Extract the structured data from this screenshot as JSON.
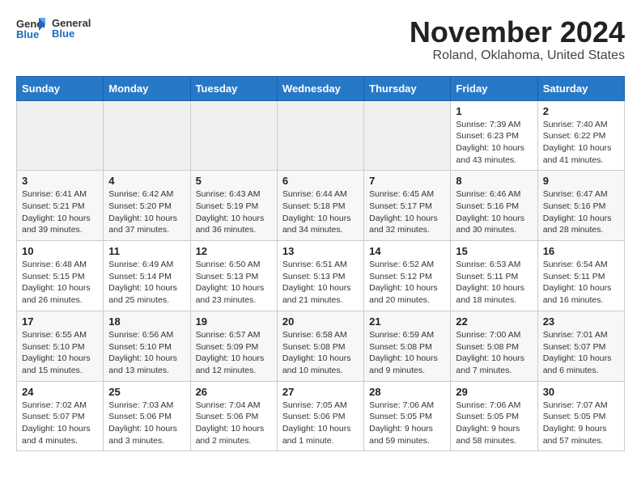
{
  "header": {
    "logo_general": "General",
    "logo_blue": "Blue",
    "month_title": "November 2024",
    "location": "Roland, Oklahoma, United States"
  },
  "weekdays": [
    "Sunday",
    "Monday",
    "Tuesday",
    "Wednesday",
    "Thursday",
    "Friday",
    "Saturday"
  ],
  "weeks": [
    [
      {
        "day": "",
        "detail": ""
      },
      {
        "day": "",
        "detail": ""
      },
      {
        "day": "",
        "detail": ""
      },
      {
        "day": "",
        "detail": ""
      },
      {
        "day": "",
        "detail": ""
      },
      {
        "day": "1",
        "detail": "Sunrise: 7:39 AM\nSunset: 6:23 PM\nDaylight: 10 hours and 43 minutes."
      },
      {
        "day": "2",
        "detail": "Sunrise: 7:40 AM\nSunset: 6:22 PM\nDaylight: 10 hours and 41 minutes."
      }
    ],
    [
      {
        "day": "3",
        "detail": "Sunrise: 6:41 AM\nSunset: 5:21 PM\nDaylight: 10 hours and 39 minutes."
      },
      {
        "day": "4",
        "detail": "Sunrise: 6:42 AM\nSunset: 5:20 PM\nDaylight: 10 hours and 37 minutes."
      },
      {
        "day": "5",
        "detail": "Sunrise: 6:43 AM\nSunset: 5:19 PM\nDaylight: 10 hours and 36 minutes."
      },
      {
        "day": "6",
        "detail": "Sunrise: 6:44 AM\nSunset: 5:18 PM\nDaylight: 10 hours and 34 minutes."
      },
      {
        "day": "7",
        "detail": "Sunrise: 6:45 AM\nSunset: 5:17 PM\nDaylight: 10 hours and 32 minutes."
      },
      {
        "day": "8",
        "detail": "Sunrise: 6:46 AM\nSunset: 5:16 PM\nDaylight: 10 hours and 30 minutes."
      },
      {
        "day": "9",
        "detail": "Sunrise: 6:47 AM\nSunset: 5:16 PM\nDaylight: 10 hours and 28 minutes."
      }
    ],
    [
      {
        "day": "10",
        "detail": "Sunrise: 6:48 AM\nSunset: 5:15 PM\nDaylight: 10 hours and 26 minutes."
      },
      {
        "day": "11",
        "detail": "Sunrise: 6:49 AM\nSunset: 5:14 PM\nDaylight: 10 hours and 25 minutes."
      },
      {
        "day": "12",
        "detail": "Sunrise: 6:50 AM\nSunset: 5:13 PM\nDaylight: 10 hours and 23 minutes."
      },
      {
        "day": "13",
        "detail": "Sunrise: 6:51 AM\nSunset: 5:13 PM\nDaylight: 10 hours and 21 minutes."
      },
      {
        "day": "14",
        "detail": "Sunrise: 6:52 AM\nSunset: 5:12 PM\nDaylight: 10 hours and 20 minutes."
      },
      {
        "day": "15",
        "detail": "Sunrise: 6:53 AM\nSunset: 5:11 PM\nDaylight: 10 hours and 18 minutes."
      },
      {
        "day": "16",
        "detail": "Sunrise: 6:54 AM\nSunset: 5:11 PM\nDaylight: 10 hours and 16 minutes."
      }
    ],
    [
      {
        "day": "17",
        "detail": "Sunrise: 6:55 AM\nSunset: 5:10 PM\nDaylight: 10 hours and 15 minutes."
      },
      {
        "day": "18",
        "detail": "Sunrise: 6:56 AM\nSunset: 5:10 PM\nDaylight: 10 hours and 13 minutes."
      },
      {
        "day": "19",
        "detail": "Sunrise: 6:57 AM\nSunset: 5:09 PM\nDaylight: 10 hours and 12 minutes."
      },
      {
        "day": "20",
        "detail": "Sunrise: 6:58 AM\nSunset: 5:08 PM\nDaylight: 10 hours and 10 minutes."
      },
      {
        "day": "21",
        "detail": "Sunrise: 6:59 AM\nSunset: 5:08 PM\nDaylight: 10 hours and 9 minutes."
      },
      {
        "day": "22",
        "detail": "Sunrise: 7:00 AM\nSunset: 5:08 PM\nDaylight: 10 hours and 7 minutes."
      },
      {
        "day": "23",
        "detail": "Sunrise: 7:01 AM\nSunset: 5:07 PM\nDaylight: 10 hours and 6 minutes."
      }
    ],
    [
      {
        "day": "24",
        "detail": "Sunrise: 7:02 AM\nSunset: 5:07 PM\nDaylight: 10 hours and 4 minutes."
      },
      {
        "day": "25",
        "detail": "Sunrise: 7:03 AM\nSunset: 5:06 PM\nDaylight: 10 hours and 3 minutes."
      },
      {
        "day": "26",
        "detail": "Sunrise: 7:04 AM\nSunset: 5:06 PM\nDaylight: 10 hours and 2 minutes."
      },
      {
        "day": "27",
        "detail": "Sunrise: 7:05 AM\nSunset: 5:06 PM\nDaylight: 10 hours and 1 minute."
      },
      {
        "day": "28",
        "detail": "Sunrise: 7:06 AM\nSunset: 5:05 PM\nDaylight: 9 hours and 59 minutes."
      },
      {
        "day": "29",
        "detail": "Sunrise: 7:06 AM\nSunset: 5:05 PM\nDaylight: 9 hours and 58 minutes."
      },
      {
        "day": "30",
        "detail": "Sunrise: 7:07 AM\nSunset: 5:05 PM\nDaylight: 9 hours and 57 minutes."
      }
    ]
  ]
}
